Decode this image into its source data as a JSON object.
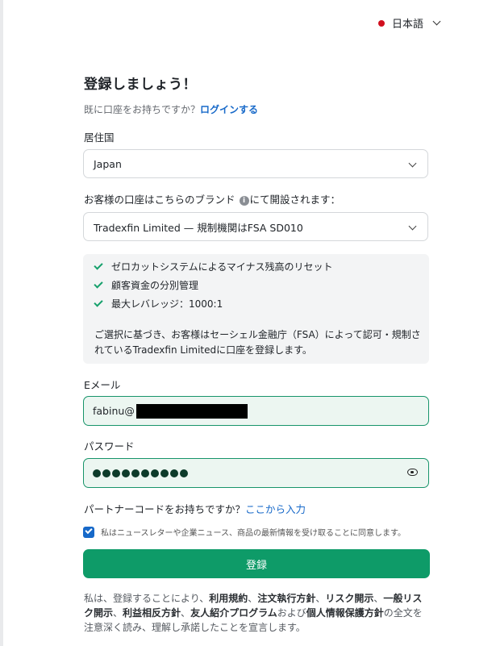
{
  "language": {
    "label": "日本語",
    "flag_color": "#d10f1e"
  },
  "title": "登録しましょう！",
  "subtitle": {
    "text": "既に口座をお持ちですか？",
    "login_link": "ログインする"
  },
  "residence": {
    "label": "居住国",
    "value": "Japan"
  },
  "brand": {
    "label_before": "お客様の口座はこちらのブランド",
    "label_after": "にて開設されます：",
    "value": "Tradexfin Limited — 規制機関はFSA SD010"
  },
  "features": [
    "ゼロカットシステムによるマイナス残高のリセット",
    "顧客資金の分別管理",
    "最大レバレッジ：1000:1"
  ],
  "notice": "ご選択に基づき、お客様はセーシェル金融庁（FSA）によって認可・規制されているTradexfin Limitedに口座を登録します。",
  "email": {
    "label": "Eメール",
    "value": "fabinu@"
  },
  "password": {
    "label": "パスワード",
    "dots": 10
  },
  "partner": {
    "text": "パートナーコードをお持ちですか？",
    "link": "ここから入力"
  },
  "newsletter": {
    "checked": true,
    "text": "私はニュースレターや企業ニュース、商品の最新情報を受け取ることに同意します。"
  },
  "submit_label": "登録",
  "legal": {
    "p1": "私は、登録することにより、",
    "t1": "利用規約",
    "s1": "、",
    "t2": "注文執行方針",
    "s2": "、",
    "t3": "リスク開示",
    "s3": "、",
    "t4": "一般リスク開示",
    "s4": "、",
    "t5": "利益相反方針",
    "s5": "、",
    "t6": "友人紹介プログラム",
    "s6": "および",
    "t7": "個人情報保護方針",
    "p2": "の全文を注意深く読み、理解し承諾したことを宣言します。"
  },
  "colors": {
    "accent": "#0e9b68",
    "link": "#1769c9",
    "input_bg": "#ecf6f1"
  }
}
